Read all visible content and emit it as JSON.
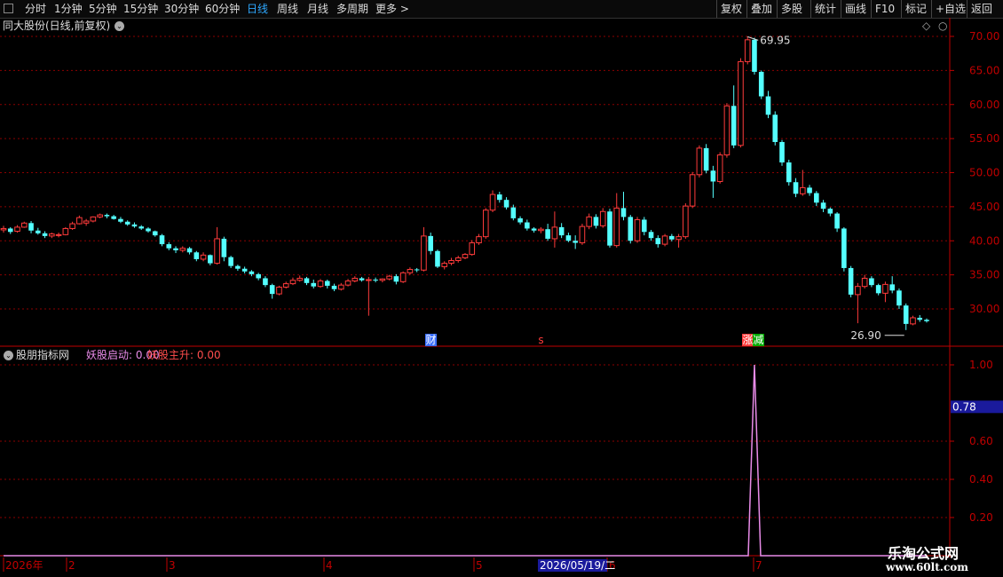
{
  "toolbar": {
    "periods": [
      "分时",
      "1分钟",
      "5分钟",
      "15分钟",
      "30分钟",
      "60分钟",
      "日线",
      "周线",
      "月线",
      "多周期",
      "更多"
    ],
    "active_period": "日线",
    "actions": [
      "复权",
      "叠加",
      "多股",
      "统计",
      "画线",
      "F10",
      "标记",
      "+自选",
      "返回"
    ]
  },
  "stock": {
    "title": "同大股份(日线,前复权)"
  },
  "indicator": {
    "title": "股朋指标网",
    "name1": "妖股启动:",
    "value1": "0.00",
    "name2": "妖股主升:",
    "value2": "0.00"
  },
  "colors": {
    "up": "#ff3b3b",
    "down": "#54ffff",
    "grid": "#8b0000",
    "axis": "#c00000",
    "indicator_line": "#e88be8",
    "cursor_box": "#1a1a9c"
  },
  "chart_data": [
    {
      "type": "candlestick",
      "title": "同大股份(日线,前复权)",
      "ylim": [
        27,
        72
      ],
      "y_ticks": [
        "70.00",
        "65.00",
        "60.00",
        "55.00",
        "50.00",
        "45.00",
        "40.00",
        "35.00",
        "30.00"
      ],
      "annotations": {
        "high": "69.95",
        "low": "26.90"
      },
      "event_markers": [
        "财",
        "s",
        "涨",
        "减"
      ],
      "ohlc": [
        [
          41.6,
          42.2,
          41.2,
          41.8
        ],
        [
          41.8,
          42.0,
          41.0,
          41.3
        ],
        [
          41.4,
          42.3,
          41.2,
          42.0
        ],
        [
          42.0,
          42.8,
          41.9,
          42.6
        ],
        [
          42.6,
          42.9,
          41.1,
          41.5
        ],
        [
          41.5,
          41.9,
          40.9,
          41.1
        ],
        [
          41.1,
          41.4,
          40.4,
          40.7
        ],
        [
          40.7,
          41.2,
          40.4,
          41.0
        ],
        [
          40.8,
          41.2,
          40.5,
          40.9
        ],
        [
          40.9,
          42.0,
          40.8,
          41.8
        ],
        [
          41.8,
          42.8,
          41.6,
          42.5
        ],
        [
          42.5,
          43.7,
          42.4,
          43.4
        ],
        [
          42.6,
          43.2,
          42.2,
          42.9
        ],
        [
          42.9,
          43.6,
          42.7,
          43.5
        ],
        [
          43.5,
          44.0,
          43.3,
          43.8
        ],
        [
          43.8,
          44.0,
          43.3,
          43.6
        ],
        [
          43.6,
          43.8,
          43.1,
          43.2
        ],
        [
          43.2,
          43.5,
          42.6,
          42.8
        ],
        [
          42.8,
          43.0,
          42.2,
          42.4
        ],
        [
          42.4,
          42.7,
          41.9,
          42.1
        ],
        [
          42.1,
          42.3,
          41.6,
          41.8
        ],
        [
          41.8,
          42.0,
          41.2,
          41.4
        ],
        [
          41.4,
          41.5,
          40.6,
          40.8
        ],
        [
          40.8,
          41.0,
          39.2,
          39.5
        ],
        [
          39.5,
          39.8,
          38.6,
          38.9
        ],
        [
          38.9,
          39.2,
          38.2,
          38.6
        ],
        [
          38.6,
          39.2,
          38.3,
          38.9
        ],
        [
          38.9,
          39.1,
          38.0,
          38.3
        ],
        [
          38.3,
          38.5,
          37.0,
          37.3
        ],
        [
          37.3,
          38.3,
          37.0,
          37.9
        ],
        [
          37.9,
          38.0,
          36.4,
          36.7
        ],
        [
          36.7,
          42.0,
          36.5,
          40.3
        ],
        [
          40.3,
          40.6,
          37.0,
          37.6
        ],
        [
          37.6,
          37.8,
          36.0,
          36.3
        ],
        [
          36.3,
          36.5,
          35.6,
          35.9
        ],
        [
          35.9,
          36.2,
          35.2,
          35.5
        ],
        [
          35.5,
          35.7,
          34.8,
          35.1
        ],
        [
          35.1,
          35.3,
          34.2,
          34.5
        ],
        [
          34.5,
          34.8,
          33.2,
          33.5
        ],
        [
          33.5,
          33.7,
          31.5,
          32.2
        ],
        [
          32.2,
          33.4,
          32.0,
          33.2
        ],
        [
          33.2,
          34.0,
          33.0,
          33.7
        ],
        [
          33.7,
          34.6,
          33.5,
          34.2
        ],
        [
          34.2,
          34.9,
          34.0,
          34.5
        ],
        [
          34.5,
          34.7,
          33.5,
          33.8
        ],
        [
          33.8,
          34.3,
          33.0,
          33.3
        ],
        [
          33.3,
          34.4,
          33.1,
          34.1
        ],
        [
          34.1,
          34.3,
          33.0,
          33.4
        ],
        [
          33.4,
          33.7,
          32.6,
          32.9
        ],
        [
          32.9,
          33.8,
          32.7,
          33.5
        ],
        [
          33.5,
          34.4,
          33.3,
          34.1
        ],
        [
          34.1,
          34.8,
          33.9,
          34.5
        ],
        [
          34.5,
          34.7,
          34.0,
          34.2
        ],
        [
          34.2,
          34.7,
          29.0,
          34.3
        ],
        [
          34.3,
          34.6,
          33.9,
          34.2
        ],
        [
          34.2,
          34.5,
          33.9,
          34.4
        ],
        [
          34.4,
          35.0,
          34.2,
          34.8
        ],
        [
          34.8,
          35.1,
          33.6,
          34.0
        ],
        [
          34.0,
          35.5,
          33.8,
          35.3
        ],
        [
          35.3,
          36.1,
          35.0,
          35.8
        ],
        [
          35.8,
          36.0,
          35.4,
          35.7
        ],
        [
          35.7,
          42.0,
          35.5,
          40.7
        ],
        [
          40.7,
          41.2,
          38.0,
          38.5
        ],
        [
          38.5,
          38.7,
          36.0,
          36.2
        ],
        [
          36.2,
          37.0,
          35.8,
          36.7
        ],
        [
          36.7,
          37.5,
          36.4,
          37.1
        ],
        [
          37.1,
          37.8,
          36.8,
          37.5
        ],
        [
          37.5,
          38.2,
          37.3,
          38.0
        ],
        [
          38.0,
          40.1,
          37.8,
          39.7
        ],
        [
          39.7,
          41.0,
          39.4,
          40.6
        ],
        [
          40.6,
          44.8,
          40.3,
          44.5
        ],
        [
          44.5,
          47.4,
          44.2,
          46.8
        ],
        [
          46.8,
          47.2,
          45.6,
          46.0
        ],
        [
          46.0,
          46.4,
          44.6,
          44.9
        ],
        [
          44.9,
          45.3,
          43.0,
          43.3
        ],
        [
          43.3,
          43.6,
          42.4,
          42.7
        ],
        [
          42.7,
          43.1,
          41.5,
          41.8
        ],
        [
          41.8,
          42.0,
          41.2,
          41.5
        ],
        [
          41.5,
          42.0,
          41.1,
          41.7
        ],
        [
          41.7,
          42.5,
          40.0,
          40.3
        ],
        [
          40.3,
          44.3,
          39.0,
          42.0
        ],
        [
          42.0,
          42.6,
          40.4,
          40.8
        ],
        [
          40.8,
          41.2,
          39.8,
          40.0
        ],
        [
          40.0,
          40.8,
          38.8,
          39.7
        ],
        [
          39.7,
          42.5,
          39.4,
          42.1
        ],
        [
          42.1,
          44.0,
          41.7,
          43.5
        ],
        [
          43.5,
          43.9,
          41.8,
          42.2
        ],
        [
          42.2,
          44.8,
          41.9,
          44.3
        ],
        [
          44.3,
          44.7,
          39.0,
          39.3
        ],
        [
          39.3,
          47.0,
          39.0,
          44.8
        ],
        [
          44.8,
          47.2,
          43.0,
          43.5
        ],
        [
          43.5,
          43.8,
          39.6,
          40.0
        ],
        [
          40.0,
          43.5,
          39.7,
          43.1
        ],
        [
          43.1,
          43.5,
          40.8,
          41.3
        ],
        [
          41.3,
          41.6,
          40.0,
          40.4
        ],
        [
          40.4,
          40.8,
          39.0,
          39.5
        ],
        [
          39.5,
          41.0,
          39.2,
          40.7
        ],
        [
          40.7,
          41.0,
          39.9,
          40.2
        ],
        [
          40.2,
          41.0,
          39.0,
          40.6
        ],
        [
          40.6,
          45.5,
          40.3,
          45.1
        ],
        [
          45.1,
          50.1,
          44.8,
          49.7
        ],
        [
          49.7,
          54.0,
          49.3,
          53.6
        ],
        [
          53.6,
          54.2,
          49.9,
          50.3
        ],
        [
          50.3,
          51.0,
          46.3,
          48.7
        ],
        [
          48.7,
          53.0,
          48.4,
          52.6
        ],
        [
          52.6,
          60.2,
          52.2,
          59.8
        ],
        [
          59.8,
          62.8,
          53.6,
          54.0
        ],
        [
          54.0,
          66.8,
          53.7,
          66.3
        ],
        [
          66.3,
          69.95,
          65.9,
          69.5
        ],
        [
          69.5,
          69.8,
          64.4,
          64.8
        ],
        [
          64.8,
          65.0,
          60.8,
          61.2
        ],
        [
          61.2,
          62.0,
          58.0,
          58.5
        ],
        [
          58.5,
          59.0,
          54.0,
          54.5
        ],
        [
          54.5,
          54.8,
          51.0,
          51.5
        ],
        [
          51.5,
          51.9,
          48.1,
          48.6
        ],
        [
          48.6,
          49.2,
          46.4,
          46.9
        ],
        [
          46.9,
          50.4,
          46.6,
          47.8
        ],
        [
          47.8,
          48.2,
          46.6,
          47.0
        ],
        [
          47.0,
          47.3,
          45.1,
          45.6
        ],
        [
          45.6,
          46.0,
          44.2,
          44.7
        ],
        [
          44.7,
          44.9,
          43.6,
          44.0
        ],
        [
          44.0,
          44.2,
          41.3,
          41.8
        ],
        [
          41.8,
          42.0,
          35.5,
          36.0
        ],
        [
          36.0,
          36.3,
          31.7,
          32.1
        ],
        [
          32.1,
          33.8,
          27.9,
          33.3
        ],
        [
          33.3,
          35.0,
          33.0,
          34.5
        ],
        [
          34.5,
          34.8,
          33.2,
          33.5
        ],
        [
          33.5,
          33.7,
          32.0,
          32.3
        ],
        [
          32.3,
          34.0,
          31.0,
          33.6
        ],
        [
          33.6,
          34.8,
          32.3,
          32.7
        ],
        [
          32.7,
          33.0,
          30.0,
          30.5
        ],
        [
          30.5,
          30.8,
          26.9,
          27.8
        ],
        [
          27.8,
          29.0,
          27.6,
          28.7
        ],
        [
          28.7,
          29.1,
          28.1,
          28.4
        ],
        [
          28.4,
          28.6,
          28.0,
          28.2
        ]
      ],
      "x_labels": [
        "2026年",
        "2",
        "3",
        "4",
        "5",
        "6",
        "7"
      ]
    },
    {
      "type": "line",
      "title": "股朋指标网",
      "ylim": [
        0,
        1.1
      ],
      "y_ticks": [
        "1.00",
        "0.60",
        "0.40",
        "0.20"
      ],
      "cursor_value": "0.78",
      "cursor_date": "2026/05/19/二",
      "series": [
        {
          "name": "妖股启动",
          "spike_at_index": 109,
          "spike_value": 1.0,
          "baseline": 0.0
        }
      ]
    }
  ]
}
